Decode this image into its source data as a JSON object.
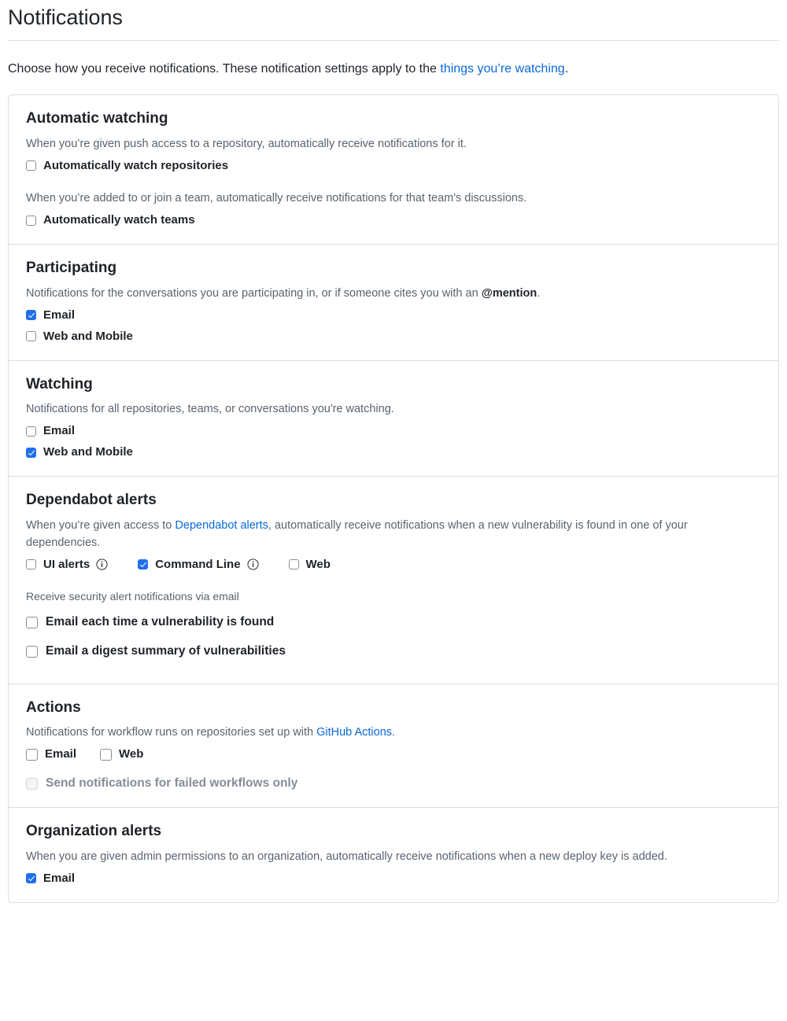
{
  "header": {
    "title": "Notifications"
  },
  "intro": {
    "text_before": "Choose how you receive notifications. These notification settings apply to the ",
    "link_label": "things you’re watching",
    "text_after": "."
  },
  "colors": {
    "link": "#0969da",
    "checkbox_checked": "#1f6feb",
    "checkbox_border": "#868f99",
    "card_border": "#d8dee4",
    "muted_text": "#59636e",
    "disabled_text": "#848d97",
    "body_text": "#1f2328"
  },
  "sections": [
    {
      "id": "automatic-watching",
      "title": "Automatic watching",
      "desc1": "When you’re given push access to a repository, automatically receive notifications for it.",
      "checkbox1": {
        "label": "Automatically watch repositories",
        "checked": false
      },
      "desc2": "When you’re added to or join a team, automatically receive notifications for that team's discussions.",
      "checkbox2": {
        "label": "Automatically watch teams",
        "checked": false
      }
    },
    {
      "id": "participating",
      "title": "Participating",
      "desc_before": "Notifications for the conversations you are participating in, or if someone cites you with an ",
      "desc_bold": "@mention",
      "desc_after": ".",
      "checkbox1": {
        "label": "Email",
        "checked": true
      },
      "checkbox2": {
        "label": "Web and Mobile",
        "checked": false
      }
    },
    {
      "id": "watching",
      "title": "Watching",
      "desc": "Notifications for all repositories, teams, or conversations you're watching.",
      "checkbox1": {
        "label": "Email",
        "checked": false
      },
      "checkbox2": {
        "label": "Web and Mobile",
        "checked": true
      }
    },
    {
      "id": "dependabot-alerts",
      "title": "Dependabot alerts",
      "desc_before": "When you’re given access to ",
      "desc_link": "Dependabot alerts",
      "desc_after": ", automatically receive notifications when a new vulnerability is found in one of your dependencies.",
      "inline": [
        {
          "label": "UI alerts",
          "checked": false,
          "info": true
        },
        {
          "label": "Command Line",
          "checked": true,
          "info": true
        },
        {
          "label": "Web",
          "checked": false,
          "info": false
        }
      ],
      "email_desc": "Receive security alert notifications via email",
      "email_options": [
        {
          "label": "Email each time a vulnerability is found",
          "checked": false
        },
        {
          "label": "Email a digest summary of vulnerabilities",
          "checked": false
        }
      ]
    },
    {
      "id": "actions",
      "title": "Actions",
      "desc_before": "Notifications for workflow runs on repositories set up with ",
      "desc_link": "GitHub Actions",
      "desc_after": ".",
      "inline": [
        {
          "label": "Email",
          "checked": false
        },
        {
          "label": "Web",
          "checked": false
        }
      ],
      "failed_only": {
        "label": "Send notifications for failed workflows only",
        "checked": false,
        "disabled": true
      }
    },
    {
      "id": "organization-alerts",
      "title": "Organization alerts",
      "desc": "When you are given admin permissions to an organization, automatically receive notifications when a new deploy key is added.",
      "checkbox1": {
        "label": "Email",
        "checked": true
      }
    }
  ],
  "icons": {
    "info": "info-icon"
  }
}
